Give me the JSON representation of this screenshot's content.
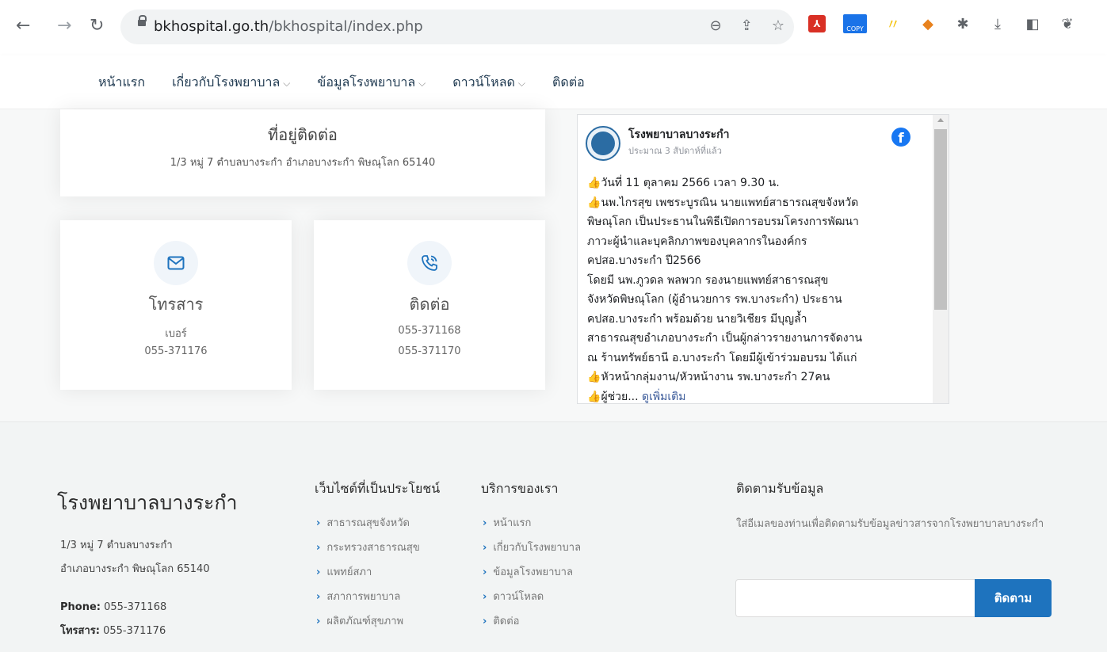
{
  "browser": {
    "url_host": "bkhospital.go.th",
    "url_path": "/bkhospital/index.php",
    "ext_copy_label": "COPY"
  },
  "nav": {
    "items": [
      {
        "label": "หน้าแรก",
        "dropdown": false
      },
      {
        "label": "เกี่ยวกับโรงพยาบาล",
        "dropdown": true
      },
      {
        "label": "ข้อมูลโรงพยาบาล",
        "dropdown": true
      },
      {
        "label": "ดาวน์โหลด",
        "dropdown": true
      },
      {
        "label": "ติดต่อ",
        "dropdown": false
      }
    ]
  },
  "address_card": {
    "title": "ที่อยู่ติดต่อ",
    "text": "1/3 หมู่ 7 ตำบลบางระกำ อำเภอบางระกำ พิษณุโลก 65140"
  },
  "fax_card": {
    "title": "โทรสาร",
    "line1": "เบอร์",
    "line2": "055-371176"
  },
  "contact_card": {
    "title": "ติดต่อ",
    "line1": "055-371168",
    "line2": "055-371170"
  },
  "facebook": {
    "page_name": "โรงพยาบาลบางระกำ",
    "time": "ประมาณ 3 สัปดาห์ที่แล้ว",
    "logo_letter": "f",
    "hand": "👍",
    "lines": [
      "วันที่ 11 ตุลาคม 2566 เวลา 9.30 น.",
      "นพ.ไกรสุข เพชระบูรณิน นายแพทย์สาธารณสุขจังหวัด",
      "พิษณุโลก เป็นประธานในพิธีเปิดการอบรมโครงการพัฒนา",
      "ภาวะผู้นำและบุคลิกภาพของบุคลากรในองค์กร",
      "คปสอ.บางระกำ ปี2566",
      "โดยมี นพ.ภูวดล พลพวก รองนายแพทย์สาธารณสุข",
      "จังหวัดพิษณุโลก (ผู้อำนวยการ รพ.บางระกำ) ประธาน",
      "คปสอ.บางระกำ พร้อมด้วย นายวิเชียร มีบุญล้ำ",
      "สาธารณสุขอำเภอบางระกำ เป็นผู้กล่าวรายงานการจัดงาน",
      "ณ ร้านทรัพย์ธานี อ.บางระกำ โดยมีผู้เข้าร่วมอบรม ได้แก่",
      "หัวหน้ากลุ่มงาน/หัวหน้างาน รพ.บางระกำ 27คน",
      "ผู้ช่วย..."
    ],
    "see_more": "ดูเพิ่มเติม"
  },
  "footer": {
    "brand": "โรงพยาบาลบางระกำ",
    "address_line1": "1/3 หมู่ 7 ตำบลบางระกำ",
    "address_line2": "อำเภอบางระกำ พิษณุโลก 65140",
    "phone_label": "Phone:",
    "phone_value": " 055-371168",
    "fax_label": "โทรสาร:",
    "fax_value": " 055-371176",
    "useful_title": "เว็บไซต์ที่เป็นประโยชน์",
    "useful_links": [
      "สาธารณสุขจังหวัด",
      "กระทรวงสาธารณสุข",
      "แพทย์สภา",
      "สภาการพยาบาล",
      "ผลิตภัณฑ์สุขภาพ"
    ],
    "services_title": "บริการของเรา",
    "service_links": [
      "หน้าแรก",
      "เกี่ยวกับโรงพยาบาล",
      "ข้อมูลโรงพยาบาล",
      "ดาวน์โหลด",
      "ติดต่อ"
    ],
    "subscribe_title": "ติดตามรับข้อมูล",
    "subscribe_text": "ใส่อีเมลของท่านเพื่อติดตามรับข้อมูลข่าวสารจากโรงพยาบาลบางระกำ",
    "subscribe_button": "ติดตาม",
    "subscribe_value": ""
  },
  "colors": {
    "accent": "#1e73be",
    "facebook": "#1877f2"
  }
}
